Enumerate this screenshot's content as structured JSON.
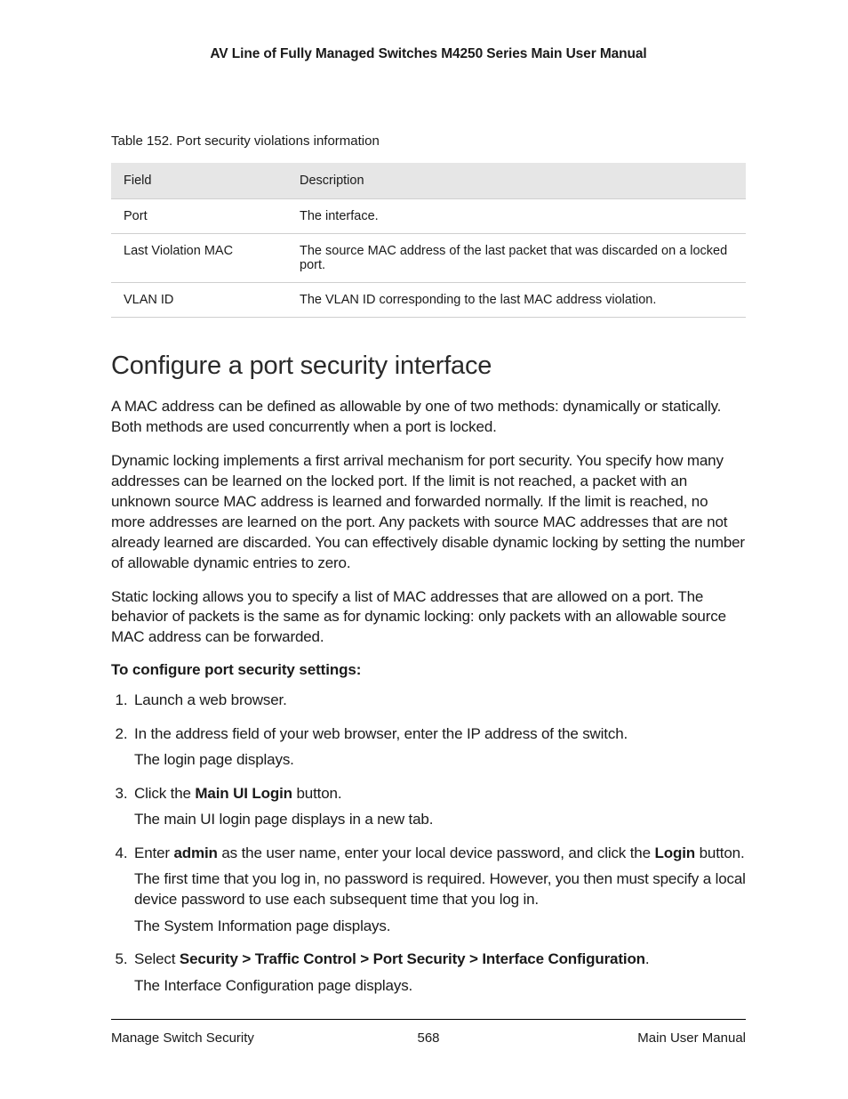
{
  "header": {
    "title": "AV Line of Fully Managed Switches M4250 Series Main User Manual"
  },
  "table": {
    "caption": "Table 152. Port security violations information",
    "headers": {
      "field": "Field",
      "description": "Description"
    },
    "rows": [
      {
        "field": "Port",
        "description": "The interface."
      },
      {
        "field": "Last Violation MAC",
        "description": "The source MAC address of the last packet that was discarded on a locked port."
      },
      {
        "field": "VLAN ID",
        "description": "The VLAN ID corresponding to the last MAC address violation."
      }
    ]
  },
  "section": {
    "heading": "Configure a port security interface",
    "p1": "A MAC address can be defined as allowable by one of two methods: dynamically or statically. Both methods are used concurrently when a port is locked.",
    "p2": "Dynamic locking implements a first arrival mechanism for port security. You specify how many addresses can be learned on the locked port. If the limit is not reached, a packet with an unknown source MAC address is learned and forwarded normally. If the limit is reached, no more addresses are learned on the port. Any packets with source MAC addresses that are not already learned are discarded. You can effectively disable dynamic locking by setting the number of allowable dynamic entries to zero.",
    "p3": "Static locking allows you to specify a list of MAC addresses that are allowed on a port. The behavior of packets is the same as for dynamic locking: only packets with an allowable source MAC address can be forwarded.",
    "lead": "To configure port security settings:"
  },
  "steps": {
    "s1": "Launch a web browser.",
    "s2": "In the address field of your web browser, enter the IP address of the switch.",
    "s2b": "The login page displays.",
    "s3a": "Click the ",
    "s3bold": "Main UI Login",
    "s3b": " button.",
    "s3c": "The main UI login page displays in a new tab.",
    "s4a": "Enter ",
    "s4bold1": "admin",
    "s4b": " as the user name, enter your local device password, and click the ",
    "s4bold2": "Login",
    "s4c": " button.",
    "s4d": "The first time that you log in, no password is required. However, you then must specify a local device password to use each subsequent time that you log in.",
    "s4e": "The System Information page displays.",
    "s5a": "Select ",
    "s5bold": "Security > Traffic Control > Port Security > Interface Configuration",
    "s5b": ".",
    "s5c": "The Interface Configuration page displays."
  },
  "footer": {
    "left": "Manage Switch Security",
    "center": "568",
    "right": "Main User Manual"
  }
}
